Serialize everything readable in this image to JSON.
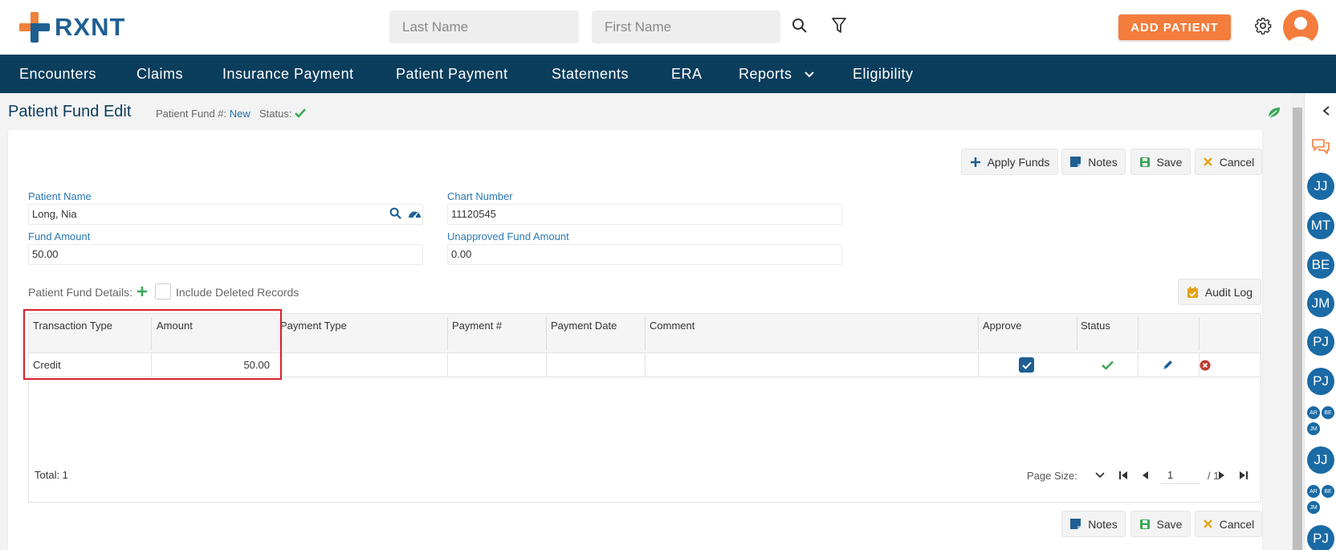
{
  "header": {
    "logo_text": "RXNT",
    "last_name_placeholder": "Last Name",
    "first_name_placeholder": "First Name",
    "add_patient_label": "ADD PATIENT"
  },
  "nav": {
    "items": [
      "Encounters",
      "Claims",
      "Insurance Payment",
      "Patient Payment",
      "Statements",
      "ERA",
      "Reports",
      "Eligibility"
    ]
  },
  "page": {
    "title": "Patient Fund Edit",
    "fund_no_label": "Patient Fund #:",
    "fund_no_value": "New",
    "status_label": "Status:"
  },
  "toolbar": {
    "apply_funds": "Apply Funds",
    "notes": "Notes",
    "save": "Save",
    "cancel": "Cancel"
  },
  "form": {
    "patient_name_label": "Patient Name",
    "patient_name_value": "Long, Nia",
    "chart_number_label": "Chart Number",
    "chart_number_value": "11120545",
    "fund_amount_label": "Fund Amount",
    "fund_amount_value": "50.00",
    "unapproved_label": "Unapproved Fund Amount",
    "unapproved_value": "0.00"
  },
  "details": {
    "label": "Patient Fund Details:",
    "include_deleted_label": "Include Deleted Records",
    "audit_log_label": "Audit Log"
  },
  "grid": {
    "columns": [
      "Transaction Type",
      "Amount",
      "Payment Type",
      "Payment #",
      "Payment Date",
      "Comment",
      "Approve",
      "Status"
    ],
    "rows": [
      {
        "transaction_type": "Credit",
        "amount": "50.00",
        "payment_type": "",
        "payment_no": "",
        "payment_date": "",
        "comment": "",
        "approved": true
      }
    ],
    "total_label": "Total: 1",
    "page_size_label": "Page Size:",
    "page_value": "1",
    "page_of": "/ 1"
  },
  "sidebar": {
    "avatars_big": [
      "JJ",
      "MT",
      "BE",
      "JM",
      "PJ",
      "PJ"
    ],
    "group1": [
      "AR",
      "BE",
      "JM"
    ],
    "avatar_after_group1": "JJ",
    "group2": [
      "AR",
      "BE",
      "JM"
    ],
    "avatar_last": "PJ"
  },
  "colors": {
    "brand_blue": "#1e5f93",
    "nav_bg": "#0b3d5c",
    "accent_orange": "#f47c3c",
    "success_green": "#3aa757",
    "danger_red": "#c0392b",
    "link_blue": "#2a77b5"
  }
}
